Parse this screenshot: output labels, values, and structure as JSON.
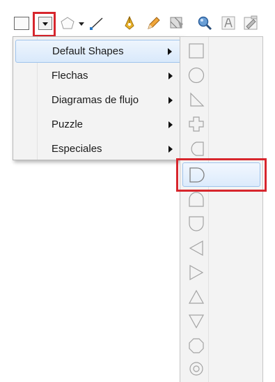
{
  "toolbar": {
    "tools": [
      {
        "name": "rectangle-tool-icon"
      },
      {
        "name": "dropdown-arrow-icon"
      },
      {
        "name": "basic-shapes-icon"
      },
      {
        "name": "line-tool-icon"
      },
      {
        "name": "pen-curve-icon"
      },
      {
        "name": "pencil-icon"
      },
      {
        "name": "pattern-fill-icon"
      },
      {
        "name": "zoom-icon"
      },
      {
        "name": "text-frame-icon"
      },
      {
        "name": "page-edit-icon"
      }
    ],
    "highlight_color": "#d7262d"
  },
  "menu": {
    "items": [
      {
        "label": "Default Shapes",
        "selected": true
      },
      {
        "label": "Flechas"
      },
      {
        "label": "Diagramas de flujo"
      },
      {
        "label": "Puzzle"
      },
      {
        "label": "Especiales"
      }
    ]
  },
  "shapes": {
    "items": [
      {
        "name": "square-shape-icon"
      },
      {
        "name": "circle-shape-icon"
      },
      {
        "name": "right-triangle-shape-icon"
      },
      {
        "name": "cross-shape-icon"
      },
      {
        "name": "half-round-left-shape-icon"
      },
      {
        "name": "half-round-right-shape-icon",
        "selected": true
      },
      {
        "name": "half-round-top-shape-icon"
      },
      {
        "name": "half-round-bottom-shape-icon"
      },
      {
        "name": "triangle-left-shape-icon"
      },
      {
        "name": "triangle-right-shape-icon"
      },
      {
        "name": "triangle-up-shape-icon"
      },
      {
        "name": "triangle-down-shape-icon"
      },
      {
        "name": "octagon-shape-icon"
      },
      {
        "name": "target-shape-icon"
      }
    ]
  }
}
